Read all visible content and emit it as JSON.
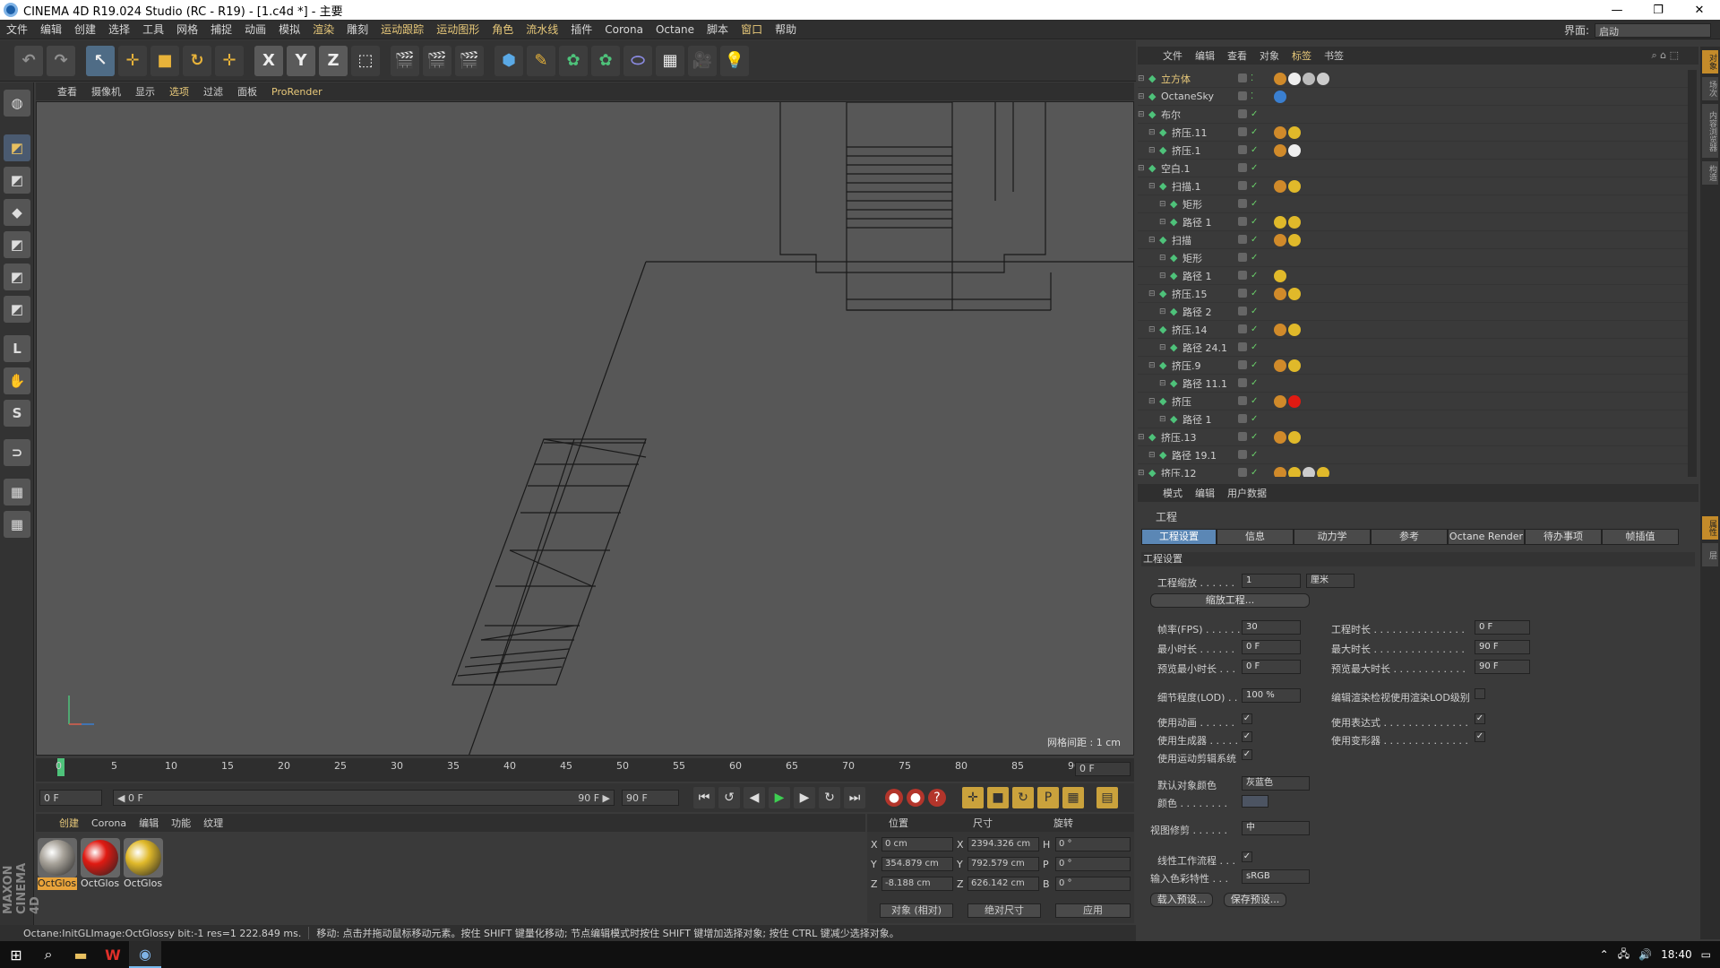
{
  "window": {
    "title": "CINEMA 4D R19.024 Studio (RC - R19) - [1.c4d *] - 主要"
  },
  "menu": [
    "文件",
    "编辑",
    "创建",
    "选择",
    "工具",
    "网格",
    "捕捉",
    "动画",
    "模拟",
    "渲染",
    "雕刻",
    "运动跟踪",
    "运动图形",
    "角色",
    "流水线",
    "插件",
    "Corona",
    "Octane",
    "脚本",
    "窗口",
    "帮助"
  ],
  "layout": {
    "label": "界面:",
    "value": "启动"
  },
  "toolbar": [
    "↖",
    "✛",
    "■",
    "↻",
    "✛",
    "X",
    "Y",
    "Z",
    "⬚",
    "🎬",
    "🎬",
    "🎬",
    "⬢",
    "✎",
    "✿",
    "✿",
    "⬭",
    "▦",
    "🎥",
    "💡"
  ],
  "left_tools": [
    "◩",
    "◩",
    "◆",
    "◩",
    "◩",
    "◩",
    "L",
    "✋",
    "S",
    "⊃",
    "▦",
    "▦"
  ],
  "viewport": {
    "menu": [
      "查看",
      "摄像机",
      "显示",
      "选项",
      "过滤",
      "面板",
      "ProRender"
    ],
    "grid_label": "网格间距 : 1 cm"
  },
  "timeline": {
    "ticks": [
      "0",
      "5",
      "10",
      "15",
      "20",
      "25",
      "30",
      "35",
      "40",
      "45",
      "50",
      "55",
      "60",
      "65",
      "70",
      "75",
      "80",
      "85",
      "90"
    ],
    "end_field": "0 F"
  },
  "playback": {
    "start": "0 F",
    "range_left": "◀ 0 F",
    "range_right": "90 F ▶",
    "end": "90 F"
  },
  "materials": {
    "menu": [
      "创建",
      "Corona",
      "编辑",
      "功能",
      "纹理"
    ],
    "items": [
      {
        "name": "OctGlos",
        "color": "#a8a39a"
      },
      {
        "name": "OctGlos",
        "color": "#e01a12"
      },
      {
        "name": "OctGlos",
        "color": "#e0b92a"
      }
    ]
  },
  "maxon": "MAXON CINEMA 4D",
  "coordinates": {
    "heads": [
      "位置",
      "尺寸",
      "旋转"
    ],
    "rows": [
      {
        "axis": "X",
        "pos": "0 cm",
        "size_axis": "X",
        "size": "2394.326 cm",
        "rot_axis": "H",
        "rot": "0 °"
      },
      {
        "axis": "Y",
        "pos": "354.879 cm",
        "size_axis": "Y",
        "size": "792.579 cm",
        "rot_axis": "P",
        "rot": "0 °"
      },
      {
        "axis": "Z",
        "pos": "-8.188 cm",
        "size_axis": "Z",
        "size": "626.142 cm",
        "rot_axis": "B",
        "rot": "0 °"
      }
    ],
    "mode1": "对象 (相对)",
    "mode2": "绝对尺寸",
    "apply": "应用"
  },
  "status": {
    "left": "Octane:InitGLImage:OctGlossy  bit:-1 res=1  222.849 ms.",
    "right": "移动: 点击并拖动鼠标移动元素。按住 SHIFT 键量化移动; 节点编辑模式时按住 SHIFT 键增加选择对象; 按住 CTRL 键减少选择对象。"
  },
  "objects": {
    "menu": [
      "文件",
      "编辑",
      "查看",
      "对象",
      "标签",
      "书签"
    ],
    "rows": [
      {
        "name": "立方体",
        "indent": 0,
        "yellow": true,
        "check": false,
        "tags": [
          "#d08a2a",
          "#eeeeee",
          "#bbbbbb",
          "#cccccc"
        ]
      },
      {
        "name": "OctaneSky",
        "indent": 0,
        "yellow": false,
        "check": false,
        "tags": [
          "#3a7fd0"
        ]
      },
      {
        "name": "布尔",
        "indent": 0,
        "yellow": false,
        "check": true,
        "tags": []
      },
      {
        "name": "挤压.11",
        "indent": 1,
        "yellow": false,
        "check": true,
        "tags": [
          "#d08a2a",
          "#e0b92a"
        ]
      },
      {
        "name": "挤压.1",
        "indent": 1,
        "yellow": false,
        "check": true,
        "tags": [
          "#d08a2a",
          "#eeeeee"
        ]
      },
      {
        "name": "空白.1",
        "indent": 0,
        "yellow": false,
        "check": true,
        "tags": []
      },
      {
        "name": "扫描.1",
        "indent": 1,
        "yellow": false,
        "check": true,
        "tags": [
          "#d08a2a",
          "#e0b92a"
        ]
      },
      {
        "name": "矩形",
        "indent": 2,
        "yellow": false,
        "check": true,
        "tags": []
      },
      {
        "name": "路径 1",
        "indent": 2,
        "yellow": false,
        "check": true,
        "tags": [
          "#e0b92a",
          "#e0b92a"
        ]
      },
      {
        "name": "扫描",
        "indent": 1,
        "yellow": false,
        "check": true,
        "tags": [
          "#d08a2a",
          "#e0b92a"
        ]
      },
      {
        "name": "矩形",
        "indent": 2,
        "yellow": false,
        "check": true,
        "tags": []
      },
      {
        "name": "路径 1",
        "indent": 2,
        "yellow": false,
        "check": true,
        "tags": [
          "#e0b92a"
        ]
      },
      {
        "name": "挤压.15",
        "indent": 1,
        "yellow": false,
        "check": true,
        "tags": [
          "#d08a2a",
          "#e0b92a"
        ]
      },
      {
        "name": "路径 2",
        "indent": 2,
        "yellow": false,
        "check": true,
        "tags": []
      },
      {
        "name": "挤压.14",
        "indent": 1,
        "yellow": false,
        "check": true,
        "tags": [
          "#d08a2a",
          "#e0b92a"
        ]
      },
      {
        "name": "路径 24.1",
        "indent": 2,
        "yellow": false,
        "check": true,
        "tags": []
      },
      {
        "name": "挤压.9",
        "indent": 1,
        "yellow": false,
        "check": true,
        "tags": [
          "#d08a2a",
          "#e0b92a"
        ]
      },
      {
        "name": "路径 11.1",
        "indent": 2,
        "yellow": false,
        "check": true,
        "tags": []
      },
      {
        "name": "挤压",
        "indent": 1,
        "yellow": false,
        "check": true,
        "tags": [
          "#d08a2a",
          "#e01a12"
        ]
      },
      {
        "name": "路径 1",
        "indent": 2,
        "yellow": false,
        "check": true,
        "tags": []
      },
      {
        "name": "挤压.13",
        "indent": 0,
        "yellow": false,
        "check": true,
        "tags": [
          "#d08a2a",
          "#e0b92a"
        ]
      },
      {
        "name": "路径 19.1",
        "indent": 1,
        "yellow": false,
        "check": true,
        "tags": []
      },
      {
        "name": "挤压.12",
        "indent": 0,
        "yellow": false,
        "check": true,
        "tags": [
          "#d08a2a",
          "#e0b92a",
          "#cccccc",
          "#e0b92a"
        ]
      }
    ]
  },
  "attributes": {
    "menu": [
      "模式",
      "编辑",
      "用户数据"
    ],
    "title": "工程",
    "tabs": [
      "工程设置",
      "信息",
      "动力学",
      "参考",
      "Octane Render",
      "待办事项",
      "帧插值"
    ],
    "section": "工程设置",
    "project_scale": {
      "label": "工程缩放 . . . . . .",
      "value": "1",
      "unit": "厘米"
    },
    "scale_btn": "缩放工程...",
    "fps": {
      "label": "帧率(FPS) . . . . . .",
      "value": "30"
    },
    "project_time": {
      "label": "工程时长 . . . . . . . . . . . . . . .",
      "value": "0 F"
    },
    "min_time": {
      "label": "最小时长 . . . . . .",
      "value": "0 F"
    },
    "max_time": {
      "label": "最大时长 . . . . . . . . . . . . . . .",
      "value": "90 F"
    },
    "preview_min": {
      "label": "预览最小时长 . . .",
      "value": "0 F"
    },
    "preview_max": {
      "label": "预览最大时长 . . . . . . . . . . . .",
      "value": "90 F"
    },
    "lod": {
      "label": "细节程度(LOD) . . .",
      "value": "100 %"
    },
    "lod_render": "编辑渲染检视使用渲染LOD级别",
    "use_anim": "使用动画 . . . . . .",
    "use_expr": "使用表达式 . . . . . . . . . . . . . .",
    "use_gen": "使用生成器 . . . . .",
    "use_deform": "使用变形器 . . . . . . . . . . . . . .",
    "use_motion": "使用运动剪辑系统",
    "default_color": {
      "label": "默认对象颜色",
      "value": "灰蓝色"
    },
    "color_label": "颜色 . . . . . . . .",
    "view_clip": {
      "label": "视图修剪 . . . . . .",
      "value": "中"
    },
    "linear": "线性工作流程 . . .",
    "input_color": {
      "label": "输入色彩特性 . . .",
      "value": "sRGB"
    },
    "load_preset": "载入预设...",
    "save_preset": "保存预设..."
  },
  "right_strip": [
    "对象",
    "场次",
    "内容浏览器",
    "构造",
    "属性",
    "层"
  ],
  "taskbar": {
    "time": "18:40"
  }
}
